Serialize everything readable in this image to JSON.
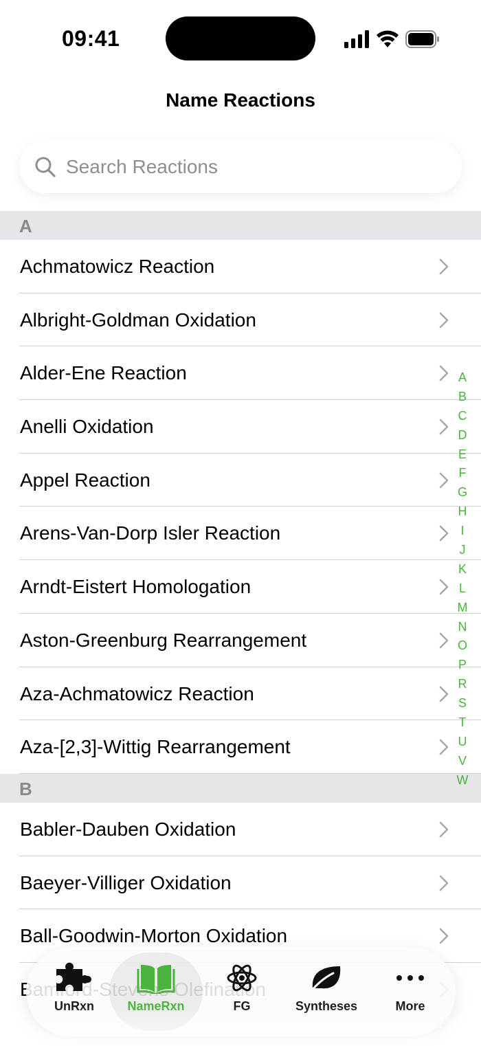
{
  "status": {
    "time": "09:41",
    "icons": [
      "cellular-signal-icon",
      "wifi-icon",
      "battery-icon"
    ]
  },
  "nav": {
    "title": "Name Reactions"
  },
  "search": {
    "placeholder": "Search Reactions",
    "value": ""
  },
  "sections": [
    {
      "letter": "A",
      "items": [
        "Achmatowicz Reaction",
        "Albright-Goldman Oxidation",
        "Alder-Ene Reaction",
        "Anelli Oxidation",
        "Appel Reaction",
        "Arens-Van-Dorp Isler Reaction",
        "Arndt-Eistert Homologation",
        "Aston-Greenburg Rearrangement",
        "Aza-Achmatowicz Reaction",
        "Aza-[2,3]-Wittig Rearrangement"
      ]
    },
    {
      "letter": "B",
      "items": [
        "Babler-Dauben Oxidation",
        "Baeyer-Villiger Oxidation",
        "Ball-Goodwin-Morton Oxidation",
        "Bamford-Stevens Olefination"
      ]
    }
  ],
  "index_letters": [
    "A",
    "B",
    "C",
    "D",
    "E",
    "F",
    "G",
    "H",
    "I",
    "J",
    "K",
    "L",
    "M",
    "N",
    "O",
    "P",
    "R",
    "S",
    "T",
    "U",
    "V",
    "W"
  ],
  "tabbar": {
    "tabs": [
      {
        "label": "UnRxn",
        "icon": "puzzle-icon",
        "active": false
      },
      {
        "label": "NameRxn",
        "icon": "book-icon",
        "active": true
      },
      {
        "label": "FG",
        "icon": "atom-icon",
        "active": false
      },
      {
        "label": "Syntheses",
        "icon": "leaf-icon",
        "active": false
      },
      {
        "label": "More",
        "icon": "more-dots-icon",
        "active": false
      }
    ]
  },
  "colors": {
    "accent": "#4cb33f",
    "section_header_bg": "#e5e5ea",
    "section_header_text": "#8a8a8e",
    "separator": "#d1d1d6",
    "placeholder": "#8e8e93"
  }
}
